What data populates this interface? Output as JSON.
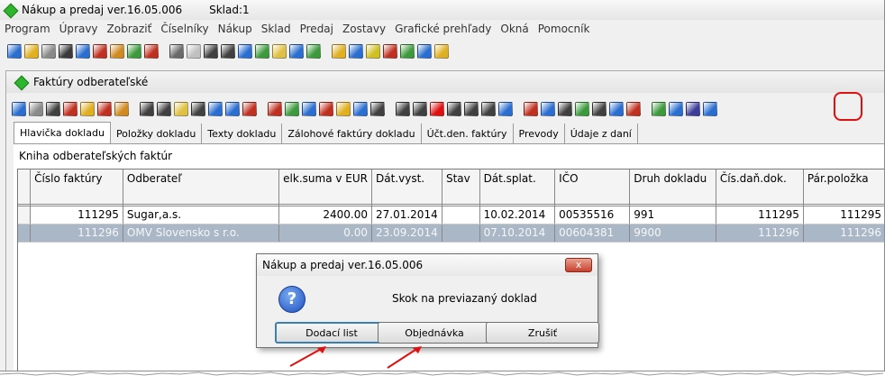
{
  "app": {
    "title": "Nákup a predaj ver.16.05.006",
    "sklad": "Sklad:1"
  },
  "menu": [
    "Program",
    "Úpravy",
    "Zobraziť",
    "Číselníky",
    "Nákup",
    "Sklad",
    "Predaj",
    "Zostavy",
    "Grafické prehľady",
    "Okná",
    "Pomocník"
  ],
  "toolbar_icon_colors": [
    "#2a6ed1",
    "#e0b020",
    "#8a8a8a",
    "#3a3a3a",
    "#2a6ed1",
    "#c03020",
    "#d08a20",
    "#3c9a3c",
    "#c03020",
    "#6a6a6a",
    "#c0c0c0",
    "#404040",
    "#404040",
    "#2a6ed1",
    "#3c9a3c",
    "#e0c040",
    "#2a6ed1",
    "#3c9a3c",
    "#e0b020",
    "#2a6ed1",
    "#d0c020",
    "#c03020",
    "#3c9a3c",
    "#2a6ed1",
    "#e0b020"
  ],
  "child": {
    "title": "Faktúry odberateľské",
    "toolbar_icon_colors": [
      "#2a6ed1",
      "#8a8a8a",
      "#404040",
      "#c03020",
      "#e0b020",
      "#c03020",
      "#d08a20",
      "#404040",
      "#404040",
      "#e0c040",
      "#404040",
      "#2a6ed1",
      "#2a6ed1",
      "#c03020",
      "#c03020",
      "#3c9a3c",
      "#2a6ed1",
      "#c03020",
      "#e0b020",
      "#2a6ed1",
      "#404040",
      "#404040",
      "#404040",
      "#e01010",
      "#404040",
      "#404040",
      "#404040",
      "#2a6ed1",
      "#c03020",
      "#2a6ed1",
      "#404040",
      "#3c9a3c",
      "#404040",
      "#2a6ed1",
      "#c03020",
      "#3c9a3c",
      "#2a6ed1",
      "#3c3c9a",
      "#2a6ed1"
    ]
  },
  "tabs": [
    "Hlavička dokladu",
    "Položky dokladu",
    "Texty dokladu",
    "Zálohové faktúry dokladu",
    "Účt.den. faktúry",
    "Prevody",
    "Údaje z daní"
  ],
  "kniha_label": "Kniha odberateľských faktúr",
  "table": {
    "headers": [
      "Číslo faktúry",
      "Odberateľ",
      "elk.suma v EUR",
      "Dát.vyst.",
      "Stav",
      "Dát.splat.",
      "IČO",
      "Druh dokladu",
      "Čís.daň.dok.",
      "Pár.položka"
    ],
    "rows": [
      [
        "111295",
        "Sugar,a.s.",
        "2400.00",
        "27.01.2014",
        "",
        "10.02.2014",
        "00535516",
        "991",
        "111295",
        "111295"
      ],
      [
        "111296",
        "OMV Slovensko s r.o.",
        "0.00",
        "23.09.2014",
        "",
        "07.10.2014",
        "00604381",
        "9900",
        "111296",
        "111296"
      ]
    ]
  },
  "dialog": {
    "title": "Nákup a predaj ver.16.05.006",
    "close": "x",
    "question": "?",
    "message": "Skok na previazaný doklad",
    "buttons": {
      "dodaci": "Dodací list",
      "objednavka": "Objednávka",
      "zrusit": "Zrušiť"
    }
  }
}
